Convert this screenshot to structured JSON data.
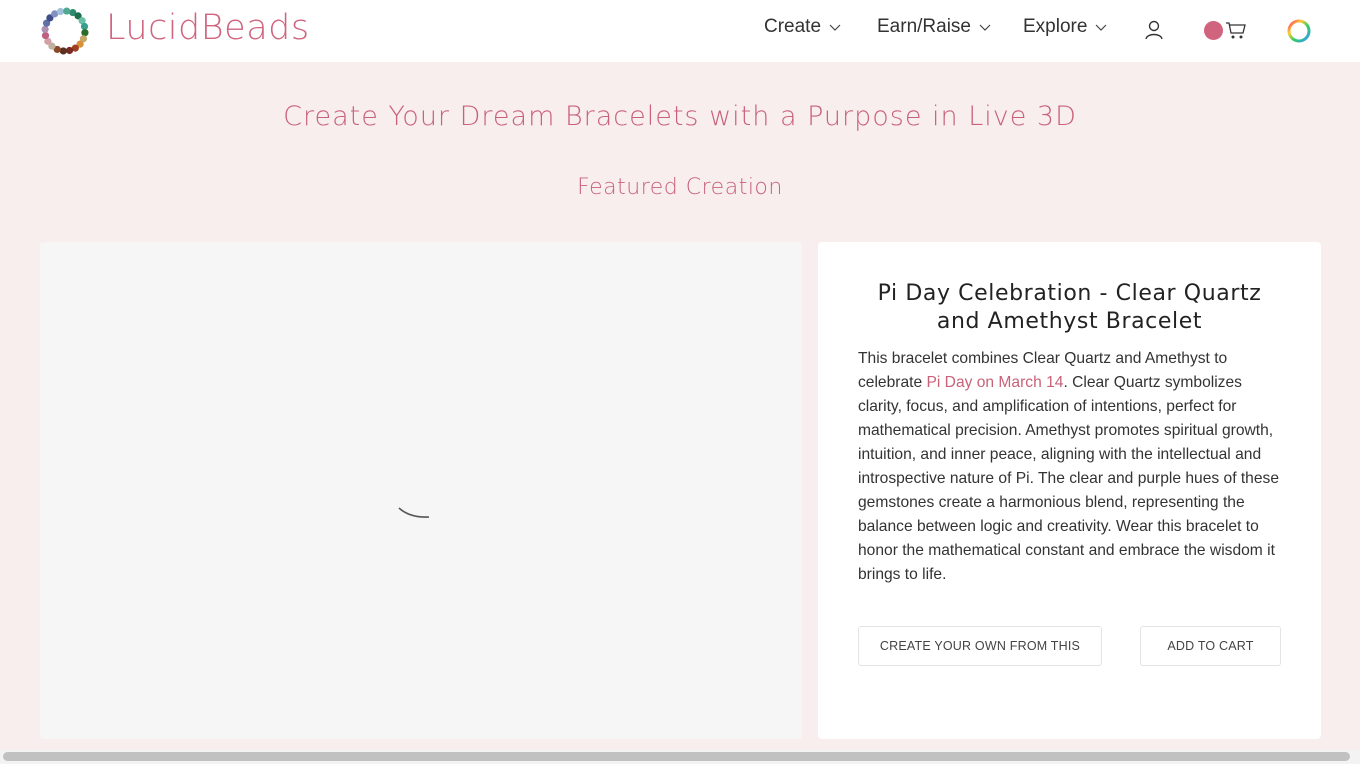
{
  "header": {
    "brand": "LucidBeads",
    "nav": [
      {
        "label": "Create",
        "icon": "chevron-down-icon"
      },
      {
        "label": "Earn/Raise",
        "icon": "chevron-down-icon"
      },
      {
        "label": "Explore",
        "icon": "chevron-down-icon"
      }
    ],
    "icons": {
      "account": "user-icon",
      "cart_badge_color": "#d0647e",
      "cart": "cart-icon",
      "theme": "color-ring-icon"
    }
  },
  "hero": {
    "title": "Create Your Dream Bracelets with a Purpose in Live 3D",
    "subtitle": "Featured Creation"
  },
  "product": {
    "title": "Pi Day Celebration - Clear Quartz and Amethyst Bracelet",
    "desc_before": "This bracelet combines Clear Quartz and Amethyst to celebrate ",
    "desc_highlight": "Pi Day on March 14",
    "desc_after": ". Clear Quartz symbolizes clarity, focus, and amplification of intentions, perfect for mathematical precision. Amethyst promotes spiritual growth, intuition, and inner peace, aligning with the intellectual and introspective nature of Pi. The clear and purple hues of these gemstones create a harmonious blend, representing the balance between logic and creativity. Wear this bracelet to honor the mathematical constant and embrace the wisdom it brings to life.",
    "buttons": {
      "create_own": "CREATE YOUR OWN FROM THIS",
      "add_to_cart": "ADD TO CART"
    }
  },
  "colors": {
    "accent": "#c86279",
    "background": "#f8eeee"
  }
}
